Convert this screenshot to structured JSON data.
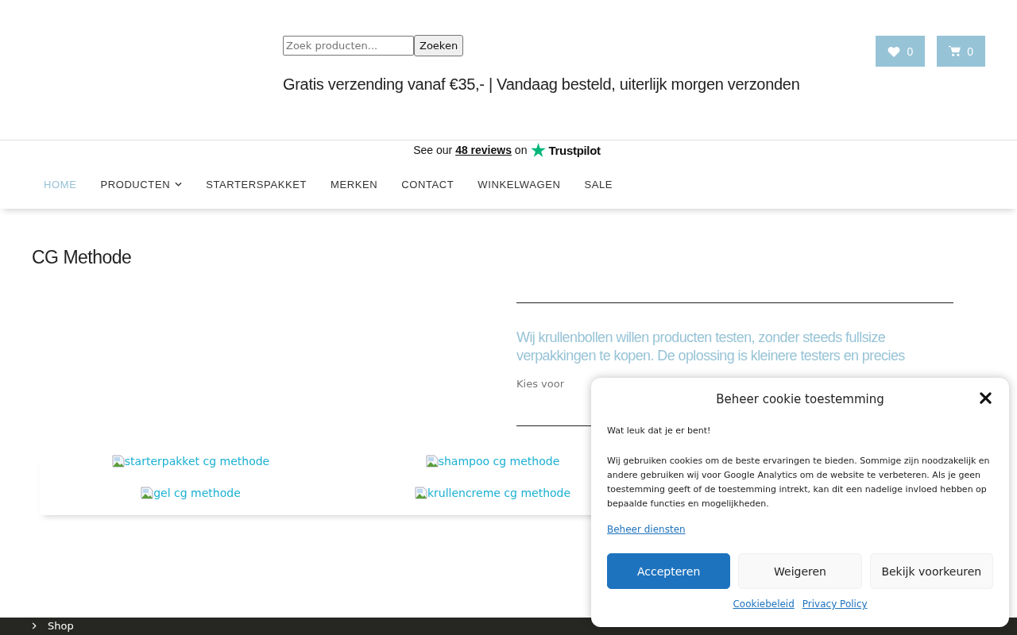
{
  "header": {
    "search": {
      "placeholder": "Zoek producten...",
      "button": "Zoeken"
    },
    "tagline": "Gratis verzending vanaf €35,- | Vandaag besteld, uiterlijk morgen verzonden",
    "wishlist_count": "0",
    "cart_count": "0"
  },
  "trustpilot": {
    "before": "See our",
    "link": "48 reviews",
    "after": "on",
    "brand": "Trustpilot"
  },
  "nav": [
    {
      "label": "HOME",
      "selected": true,
      "has_submenu": false
    },
    {
      "label": "PRODUCTEN",
      "selected": false,
      "has_submenu": true
    },
    {
      "label": "STARTERSPAKKET",
      "selected": false,
      "has_submenu": false
    },
    {
      "label": "MERKEN",
      "selected": false,
      "has_submenu": false
    },
    {
      "label": "CONTACT",
      "selected": false,
      "has_submenu": false
    },
    {
      "label": "WINKELWAGEN",
      "selected": false,
      "has_submenu": false
    },
    {
      "label": "SALE",
      "selected": false,
      "has_submenu": false
    }
  ],
  "page_title": "CG Methode",
  "intro": {
    "heading": "Wij krullenbollen willen producten testen, zonder steeds fullsize verpakkingen te kopen. De oplossing is kleinere testers en precies",
    "text": "Kies voor"
  },
  "products": [
    {
      "alt": "starterpakket cg methode"
    },
    {
      "alt": "shampoo cg methode"
    },
    {
      "alt": "gel cg methode"
    },
    {
      "alt": "krullencreme cg methode"
    }
  ],
  "footer": {
    "item": "Shop"
  },
  "cookie_dialog": {
    "title": "Beheer cookie toestemming",
    "greeting": "Wat leuk dat je er bent!",
    "body": "Wij gebruiken cookies om de beste ervaringen te bieden. Sommige zijn noodzakelijk en andere gebruiken wij voor Google Analytics om de website te verbeteren. Als je geen toestemming geeft of de toestemming intrekt, kan dit een nadelige invloed hebben op bepaalde functies en mogelijkheden.",
    "manage_link": "Beheer diensten",
    "buttons": [
      {
        "label": "Accepteren",
        "kind": "primary"
      },
      {
        "label": "Weigeren",
        "kind": "secondary"
      },
      {
        "label": "Bekijk voorkeuren",
        "kind": "secondary"
      }
    ],
    "links": [
      "Cookiebeleid",
      "Privacy Policy"
    ]
  }
}
